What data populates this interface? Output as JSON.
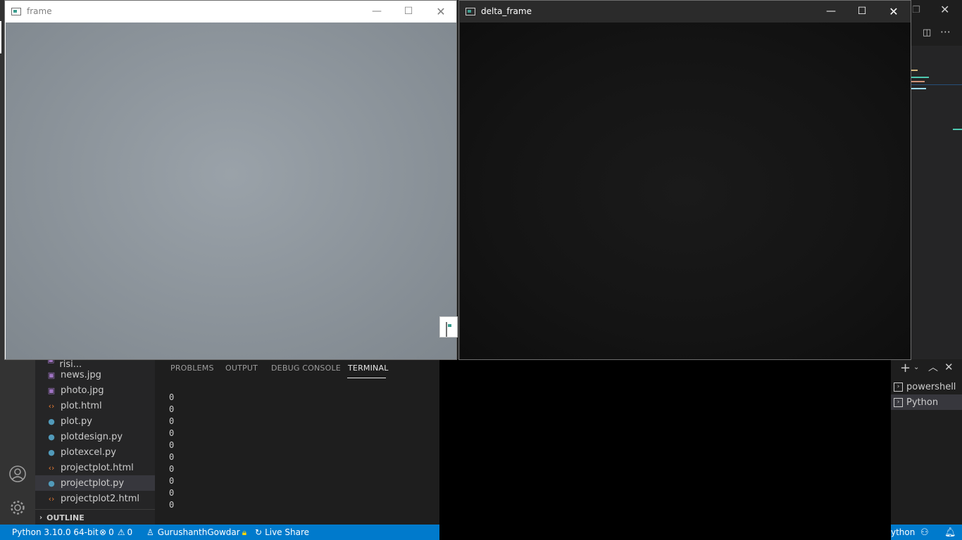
{
  "explorer": {
    "files": [
      {
        "name": "Moon sinking, sun risi...",
        "icon": "image-file-icon",
        "type": "img"
      },
      {
        "name": "news.jpg",
        "icon": "image-file-icon",
        "type": "img"
      },
      {
        "name": "photo.jpg",
        "icon": "image-file-icon",
        "type": "img"
      },
      {
        "name": "plot.html",
        "icon": "html-file-icon",
        "type": "html"
      },
      {
        "name": "plot.py",
        "icon": "python-file-icon",
        "type": "py"
      },
      {
        "name": "plotdesign.py",
        "icon": "python-file-icon",
        "type": "py"
      },
      {
        "name": "plotexcel.py",
        "icon": "python-file-icon",
        "type": "py"
      },
      {
        "name": "projectplot.html",
        "icon": "html-file-icon",
        "type": "html"
      },
      {
        "name": "projectplot.py",
        "icon": "python-file-icon",
        "type": "py",
        "selected": true
      },
      {
        "name": "projectplot2.html",
        "icon": "html-file-icon",
        "type": "html"
      }
    ],
    "outline_label": "OUTLINE"
  },
  "panel": {
    "tabs": [
      "PROBLEMS",
      "OUTPUT",
      "DEBUG CONSOLE",
      "TERMINAL"
    ],
    "active_tab": "TERMINAL",
    "terminal_lines": [
      "0",
      "0",
      "0",
      "0",
      "0",
      "0",
      "0",
      "0",
      "0",
      "0"
    ]
  },
  "terminal_list": {
    "items": [
      {
        "label": "powershell"
      },
      {
        "label": "Python",
        "selected": true
      }
    ]
  },
  "statusbar": {
    "interpreter": "Python 3.10.0 64-bit",
    "errors": "0",
    "warnings": "0",
    "account": "GurushanthGowdar",
    "live_share": "Live Share",
    "language_partial": "ython"
  },
  "windows": {
    "frame_title": "frame",
    "delta_title": "delta_frame"
  },
  "colors": {
    "statusbar": "#007acc",
    "activitybar": "#333333",
    "sidebar": "#252526",
    "editor": "#1e1e1e"
  }
}
